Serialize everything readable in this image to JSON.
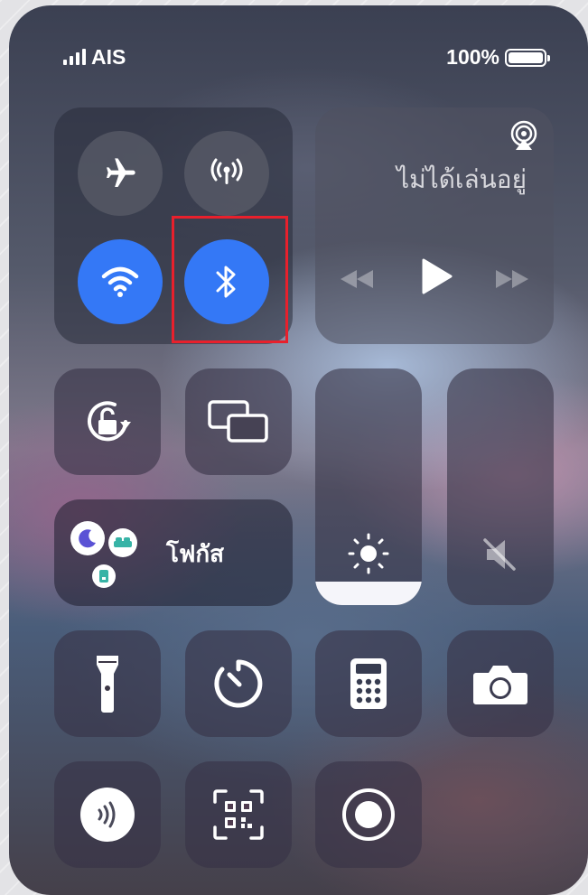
{
  "status_bar": {
    "carrier": "AIS",
    "battery_percent": "100%",
    "battery_level": 1.0
  },
  "connectivity": {
    "airplane_mode": {
      "icon": "airplane-icon",
      "on": false
    },
    "cellular_data": {
      "icon": "cellular-antenna-icon",
      "on": false
    },
    "wifi": {
      "icon": "wifi-icon",
      "on": true
    },
    "bluetooth": {
      "icon": "bluetooth-icon",
      "on": true,
      "highlighted": true
    }
  },
  "media": {
    "status": "ไม่ได้เล่นอยู่",
    "controls": [
      "airplay-icon",
      "rewind-icon",
      "play-icon",
      "fast-forward-icon"
    ]
  },
  "controls": {
    "rotation_lock": {
      "icon": "rotation-lock-icon"
    },
    "screen_mirroring": {
      "icon": "screen-mirroring-icon"
    },
    "focus": {
      "label": "โฟกัส",
      "icons": [
        "moon-icon",
        "bed-icon",
        "work-badge-icon"
      ]
    },
    "brightness": {
      "icon": "sun-icon",
      "level": 0.1
    },
    "volume": {
      "icon": "speaker-muted-icon",
      "level": 0.0
    },
    "flashlight": {
      "icon": "flashlight-icon"
    },
    "timer": {
      "icon": "timer-icon"
    },
    "calculator": {
      "icon": "calculator-icon"
    },
    "camera": {
      "icon": "camera-icon"
    },
    "nfc_reader": {
      "icon": "nfc-icon"
    },
    "qr_scanner": {
      "icon": "qr-code-scanner-icon"
    },
    "screen_record": {
      "icon": "screen-record-icon"
    }
  },
  "colors": {
    "accent_blue": "#3478f6",
    "highlight_red": "#e8202c"
  }
}
